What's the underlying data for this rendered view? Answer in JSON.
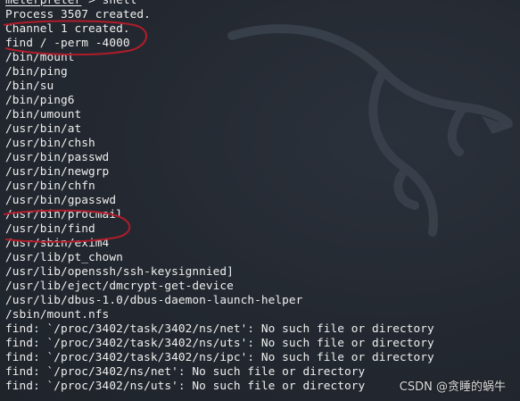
{
  "colors": {
    "background": "#232830",
    "text": "#eeeeee",
    "annotation": "#b01c2a",
    "watermark": "#d9d9d9"
  },
  "terminal": {
    "prompt_name": "meterpreter",
    "prompt_rest": " > shell",
    "lines": [
      "Process 3507 created.",
      "Channel 1 created.",
      "find / -perm -4000",
      "/bin/mount",
      "/bin/ping",
      "/bin/su",
      "/bin/ping6",
      "/bin/umount",
      "/usr/bin/at",
      "/usr/bin/chsh",
      "/usr/bin/passwd",
      "/usr/bin/newgrp",
      "/usr/bin/chfn",
      "/usr/bin/gpasswd",
      "/usr/bin/procmail",
      "/usr/bin/find",
      "/usr/sbin/exim4",
      "/usr/lib/pt_chown",
      "/usr/lib/openssh/ssh-keysignnied]",
      "/usr/lib/eject/dmcrypt-get-device",
      "/usr/lib/dbus-1.0/dbus-daemon-launch-helper",
      "/sbin/mount.nfs",
      "find: `/proc/3402/task/3402/ns/net': No such file or directory",
      "find: `/proc/3402/task/3402/ns/uts': No such file or directory",
      "find: `/proc/3402/task/3402/ns/ipc': No such file or directory",
      "find: `/proc/3402/ns/net': No such file or directory",
      "find: `/proc/3402/ns/uts': No such file or directory"
    ]
  },
  "watermark": {
    "text": "CSDN @贪睡的蜗牛"
  },
  "background_logo_icon": "kali-dragon-icon"
}
